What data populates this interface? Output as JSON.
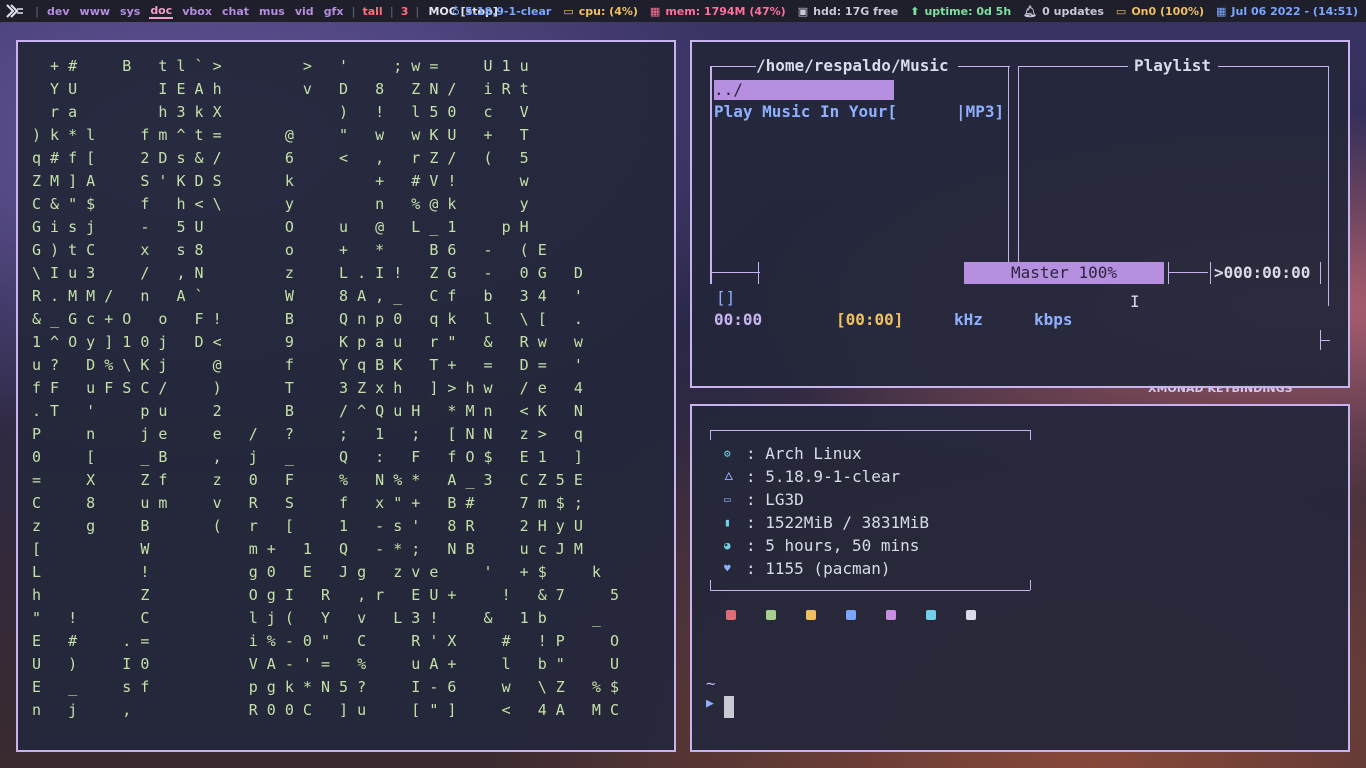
{
  "bar": {
    "workspaces": [
      "dev",
      "www",
      "sys",
      "doc",
      "vbox",
      "chat",
      "mus",
      "vid",
      "gfx"
    ],
    "current_workspace": "doc",
    "layout": "tall",
    "window_count": "3",
    "window_title": "MOC [stop]",
    "kernel": "5.18.9-1-clear",
    "cpu": "cpu: (4%)",
    "mem": "mem: 1794M (47%)",
    "hdd": "hdd: 17G free",
    "uptime": "uptime: 0d 5h",
    "updates": "0 updates",
    "battery": "On0 (100%)",
    "clock": "Jul 06 2022 - (14:51)",
    "colors": {
      "kernel": "#7aa6ff",
      "cpu": "#f0c060",
      "mem": "#ff6f9a",
      "hdd": "#c7c9d9",
      "uptime": "#7fe0a0",
      "updates": "#c7c9d9",
      "battery": "#f0c060",
      "clock": "#7aa6ff"
    }
  },
  "matrix": {
    "rows": [
      "  + #     B   t l ` >         >   '     ; w =     U 1 u",
      "  Y U         I E A h         v   D   8   Z N /   i R t",
      "  r a         h 3 k X             )   !   l 5 0   c   V",
      ") k * l     f m ^ t =       @     \"   w   w K U   +   T",
      "q # f [     2 D s & /       6     <   ,   r Z /   (   5",
      "Z M ] A     S ' K D S       k         +   # V !       w",
      "C & \" $     f   h < \\       y         n   % @ k       y",
      "G i s j     -   5 U         O     u   @   L _ 1     p H",
      "G ) t C     x   s 8         o     +   *     B 6   -   ( E",
      "\\ I u 3     /   , N         z     L . I !   Z G   -   0 G   D",
      "R . M M /   n   A `         W     8 A , _   C f   b   3 4   '",
      "& _ G c + O   o   F !       B     Q n p 0   q k   l   \\ [   .",
      "1 ^ O y ] 1 0 j   D <       9     K p a u   r \"   &   R w   w",
      "u ?   D % \\ K j     @       f     Y q B K   T +   =   D =   '",
      "f F   u F S C /     )       T     3 Z x h   ] > h w   / e   4",
      ". T   '     p u     2       B     / ^ Q u H   * M n   < K   N",
      "P     n     j e     e   /   ?     ;   1   ;   [ N N   z >   q",
      "0     [     _ B     ,   j   _     Q   :   F   f O $   E 1   ]",
      "=     X     Z f     z   0   F     %   N % *   A _ 3   C Z 5 E",
      "C     8     u m     v   R   S     f   x \" +   B #     7 m $ ;",
      "z     g     B       (   r   [     1   - s '   8 R     2 H y U",
      "[           W           m +   1   Q   - * ;   N B     u c J M",
      "L           !           g 0   E   J g   z v e     '   + $     k",
      "h           Z           O g I   R   , r   E U +     !   & 7     5",
      "\"   !       C           l j (   Y   v   L 3 !     &   1 b     _",
      "E   #     . =           i % - 0 \"   C     R ' X     #   ! P     O",
      "U   )     I 0           V A - ' =   %     u A +     l   b \"     U",
      "E   _     s f           p g k * N 5 ?     I - 6     w   \\ Z   % $",
      "n   j     ,             R 0 0 C   ] u     [ \" ]     <   4 A   M C"
    ]
  },
  "moc": {
    "directory": "/home/respaldo/Music",
    "playlist_title": "Playlist",
    "parent_entry": "../",
    "file_entry": "Play Music In Your[",
    "file_type": "|MP3]",
    "volume": "Master 100%",
    "total_time": ">000:00:00",
    "state": "[]",
    "elapsed": "00:00",
    "duration": "[00:00]",
    "khz": "kHz",
    "kbps": "kbps",
    "colors": {
      "frame": "#c9b3ee",
      "title": "#d8dbe8",
      "entry": "#8fb0ff",
      "time": "#c9b3ee",
      "select": "#b78fe0"
    }
  },
  "term": {
    "info": [
      {
        "icon": "arch-icon",
        "glyph": "⚙",
        "value": ": Arch Linux"
      },
      {
        "icon": "kernel-icon",
        "glyph": "🜂",
        "value": ": 5.18.9-1-clear"
      },
      {
        "icon": "desktop-icon",
        "glyph": "▭",
        "value": ": LG3D"
      },
      {
        "icon": "memory-icon",
        "glyph": "▮",
        "value": ": 1522MiB / 3831MiB"
      },
      {
        "icon": "uptime-icon",
        "glyph": "◕",
        "value": ": 5 hours, 50 mins"
      },
      {
        "icon": "package-icon",
        "glyph": "♥",
        "value": ": 1155 (pacman)"
      }
    ],
    "palette": [
      "#e06c75",
      "#a8d08c",
      "#f0c060",
      "#7aa6ff",
      "#c68fe0",
      "#6fd0e8",
      "#d8dbe8"
    ],
    "prompt_path": "~",
    "prompt_symbol": "▶"
  },
  "wallpaper": {
    "sign_text": "XMONAD KEYBINDINGS"
  }
}
